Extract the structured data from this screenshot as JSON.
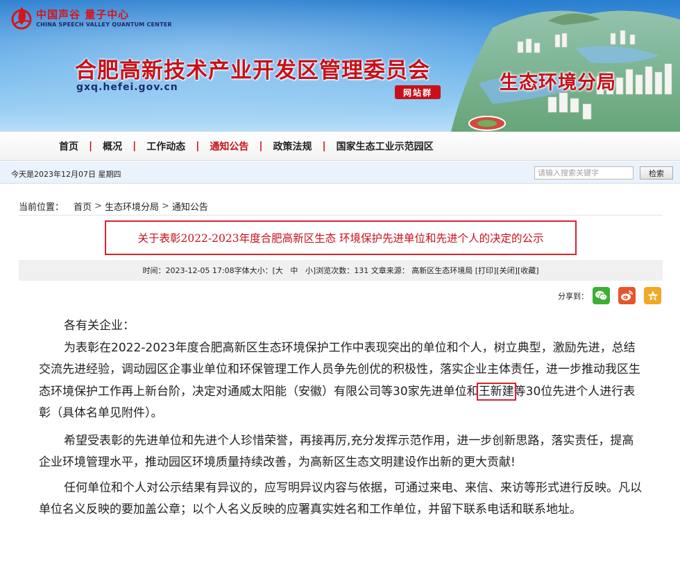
{
  "header": {
    "logo_cn": "中国声谷 量子中心",
    "logo_en": "CHINA SPEECH VALLEY QUANTUM CENTER",
    "site_title": "合肥高新技术产业开发区管理委员会",
    "site_domain": "gxq.hefei.gov.cn",
    "site_badge": "网站群",
    "bureau_title": "生态环境分局"
  },
  "nav": {
    "items": [
      {
        "label": "首页"
      },
      {
        "label": "概况"
      },
      {
        "label": "工作动态"
      },
      {
        "label": "通知公告"
      },
      {
        "label": "政策法规"
      },
      {
        "label": "国家生态工业示范园区"
      }
    ],
    "separator": "|",
    "active_index": 3
  },
  "infobar": {
    "date_text": "今天是2023年12月07日 星期四",
    "search_placeholder": "请输入搜索关键字",
    "search_button": "检索"
  },
  "breadcrumb": {
    "prefix": "当前位置：",
    "items": [
      "首页",
      "生态环境分局",
      "通知公告"
    ],
    "arrow": ">"
  },
  "article": {
    "title": "关于表彰2022-2023年度合肥高新区生态 环境保护先进单位和先进个人的决定的公示",
    "meta": {
      "time": "时间：2023-12-05 17:08",
      "font_size_label": "字体大小：",
      "font_large": "[大",
      "font_medium": "中",
      "font_small": "小]",
      "views_label": "浏览次数：",
      "views": "131",
      "source_label": "文章来源：",
      "source": "高新区生态环境局",
      "print": "[打印]",
      "close": "[关闭]",
      "favorite": "[收藏]"
    },
    "share_label": "分享到：",
    "greeting": "各有关企业：",
    "p1_before": "为表彰在2022-2023年度合肥高新区生态环境保护工作中表现突出的单位和个人，树立典型，激励先进，总结交流先进经验，调动园区企事业单位和环保管理工作人员争先创优的积极性，落实企业主体责任，进一步推动我区生态环境保护工作再上新台阶，决定对通威太阳能（安徽）有限公司等30家先进单位和",
    "p1_highlight": "王新建",
    "p1_after": "等30位先进个人进行表彰（具体名单见附件）。",
    "p2": "希望受表彰的先进单位和先进个人珍惜荣誉，再接再厉,充分发挥示范作用，进一步创新思路，落实责任，提高企业环境管理水平，推动园区环境质量持续改善，为高新区生态文明建设作出新的更大贡献!",
    "p3": "任何单位和个人对公示结果有异议的，应写明异议内容与依据，可通过来电、来信、来访等形式进行反映。凡以单位名义反映的要加盖公章；以个人名义反映的应署真实姓名和工作单位，并留下联系电话和联系地址。"
  },
  "colors": {
    "brand_red": "#c8101a",
    "highlight_border": "#d8232a",
    "banner_blue": "#2b7fd0",
    "wechat_green": "#3cb034",
    "weibo_orange": "#e8542a",
    "qzone_yellow": "#f2a823"
  },
  "icons": [
    "logo-flame-icon",
    "wechat-icon",
    "weibo-icon",
    "qzone-star-icon"
  ]
}
